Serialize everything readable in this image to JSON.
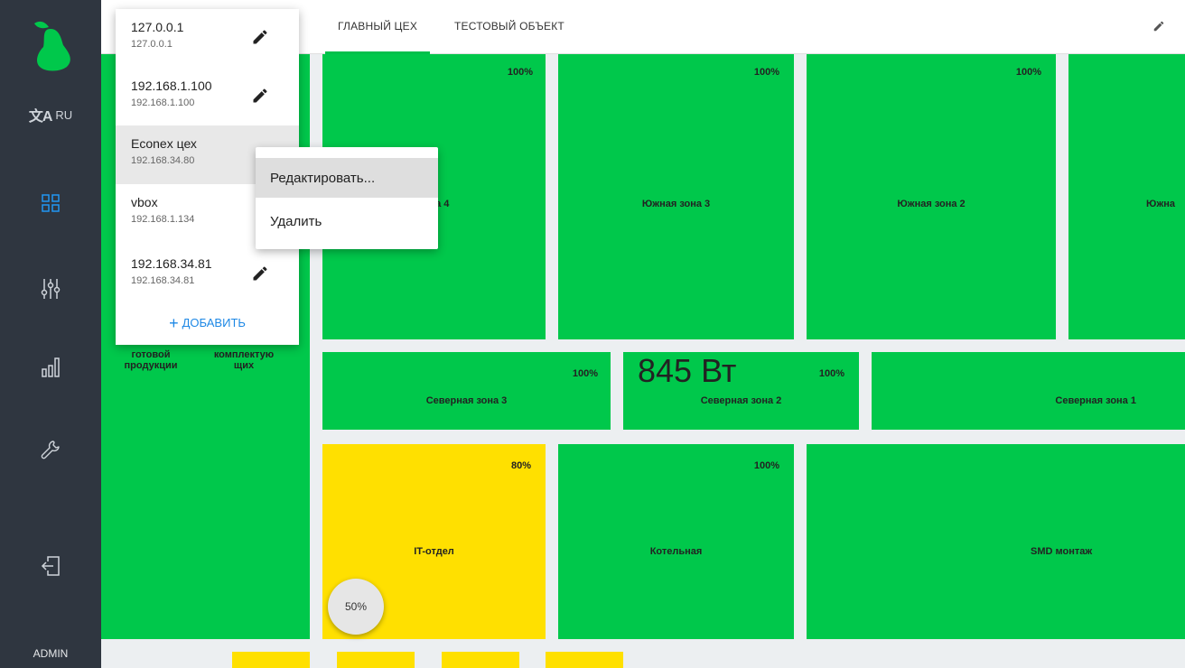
{
  "sidebar": {
    "lang": "RU",
    "user": "ADMIN",
    "icons": [
      "pear-logo-icon",
      "translate-icon",
      "dashboard-grid-icon",
      "sliders-icon",
      "bar-chart-icon",
      "wrench-icon",
      "logout-icon"
    ],
    "accent": "#2196f3"
  },
  "tabs": [
    {
      "label": "ГЛАВНЫЙ ЦЕХ",
      "active": true
    },
    {
      "label": "ТЕСТОВЫЙ ОБЪЕКТ",
      "active": false
    }
  ],
  "servers": [
    {
      "name": "127.0.0.1",
      "ip": "127.0.0.1"
    },
    {
      "name": "192.168.1.100",
      "ip": "192.168.1.100"
    },
    {
      "name": "Econex цех",
      "ip": "192.168.34.80"
    },
    {
      "name": "vbox",
      "ip": "192.168.1.134"
    },
    {
      "name": "192.168.34.81",
      "ip": "192.168.34.81"
    }
  ],
  "add_label": "ДОБАВИТЬ",
  "context_menu": {
    "edit": "Редактировать...",
    "delete": "Удалить"
  },
  "zones": {
    "z4": {
      "name": "Южная зона 4",
      "name_visible": "зона 4",
      "pct": "100%"
    },
    "z3": {
      "name": "Южная зона 3",
      "pct": "100%"
    },
    "z2": {
      "name": "Южная зона 2",
      "pct": "100%"
    },
    "z1": {
      "name": "Южна"
    },
    "left_a": "готовой продукции",
    "left_b": "комплектую щих",
    "n3": {
      "name": "Северная зона 3",
      "pct": "100%"
    },
    "n2": {
      "name": "Северная зона 2",
      "pct": "100%",
      "power": "845 Вт"
    },
    "n1": {
      "name": "Северная зона 1"
    },
    "it": {
      "name": "IT-отдел",
      "pct": "80%"
    },
    "boiler": {
      "name": "Котельная",
      "pct": "100%"
    },
    "smd": {
      "name": "SMD монтаж"
    }
  },
  "fab_pct": "50%",
  "colors": {
    "green": "#00c84b",
    "yellow": "#ffe000",
    "sidebar": "#2f3640"
  }
}
